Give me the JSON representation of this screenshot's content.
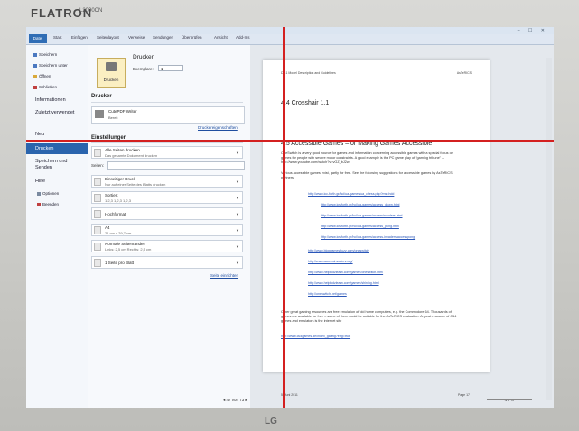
{
  "monitor": {
    "brand": "FLATRON",
    "model": "L2000CN",
    "logo": "LG"
  },
  "window": {
    "tabs": [
      "Datei",
      "Start",
      "Einfügen",
      "Seitenlayout",
      "Verweise",
      "Sendungen",
      "Überprüfen",
      "Ansicht",
      "Add-Ins"
    ],
    "controls": "– ☐ ✕"
  },
  "nav": {
    "small_items": [
      "Speichern",
      "Speichern unter",
      "Öffnen",
      "Schließen"
    ],
    "items": [
      "Informationen",
      "Zuletzt verwendet",
      "Neu",
      "Drucken",
      "Speichern und Senden",
      "Hilfe"
    ],
    "active": "Drucken",
    "footer_items": [
      "Optionen",
      "Beenden"
    ]
  },
  "print": {
    "button_label": "Drucken",
    "title": "Drucken",
    "copies_label": "Exemplare:",
    "copies_value": "1",
    "printer_header": "Drucker",
    "printer_name": "CutePDF Writer",
    "printer_status": "Bereit",
    "printer_props_link": "Druckereigenschaften",
    "settings_header": "Einstellungen",
    "pages_label": "Seiten:",
    "settings": [
      {
        "t1": "Alle Seiten drucken",
        "t2": "Das gesamte Dokument drucken"
      },
      {
        "t1": "Einseitiger Druck",
        "t2": "Nur auf einer Seite des Blatts drucken"
      },
      {
        "t1": "Sortiert",
        "t2": "1,2,3   1,2,3   1,2,3"
      },
      {
        "t1": "Hochformat",
        "t2": ""
      },
      {
        "t1": "A4",
        "t2": "21 cm x 29,7 cm"
      },
      {
        "t1": "Normale Seitenränder",
        "t2": "Links: 2,5 cm   Rechts: 2,5 cm"
      },
      {
        "t1": "1 Seite pro Blatt",
        "t2": ""
      }
    ],
    "page_setup_link": "Seite einrichten"
  },
  "preview": {
    "header_left": "D2.1 Model Description and Guidelines",
    "header_right": "AsTeRICS",
    "section_44": "4.4     Crosshair 1.1",
    "section_45": "4.5     Accessible Games – or Making Games Accessible",
    "para1": "OneSwitch is a very good source for games and information concerning accessible games with a special focus on games for people with severe motor constraints. A good example is the PC game play of \"gaming tribune\" – http://www.youtube.com/watch?v=vGZ_bJ2w",
    "para2": "Various accessible games exist, partly for free. See the following suggestions for accessible games by AsTeRICS partners:",
    "links_a": [
      "http://www.icc-forth.gr/hci/ua-games/ua_chess.php?ms=hdd",
      "http://www.ics.forth.gr/hci/ua-games/access_down.html",
      "http://www.ics.forth.gr/hci/ua-games/accessinvaders.html",
      "http://www.ics.forth.gr/hci/ua-games/access_pong.html",
      "http://www.ics.forth.gr/hci/ua-games/access-invaders/accesspong"
    ],
    "links_b": [
      "http://www.bloggamesbuzz.com/oneswitch",
      "http://www.accessinvaders.org/",
      "http://www.helpkidzlearn.com/games/oneswitch.html",
      "http://www.helpkidzlearn.com/games/shining.html",
      "http://oneswitch.net/games"
    ],
    "para3": "Other great gaming resources are free emulation of old home computers, e.g. the Commodore 64. Thousands of games are available for free – some of them could be suitable for the AsTeRICS evaluation. A great resource of C64 games and emulators is the internet site",
    "link_c": "http://www.c64games.de/index_gaeng?eng=true",
    "footer_left": "5. Juni 2011",
    "footer_right": "Page 17",
    "pager": "◂  47  von 73  ▸",
    "zoom": "47 %"
  }
}
